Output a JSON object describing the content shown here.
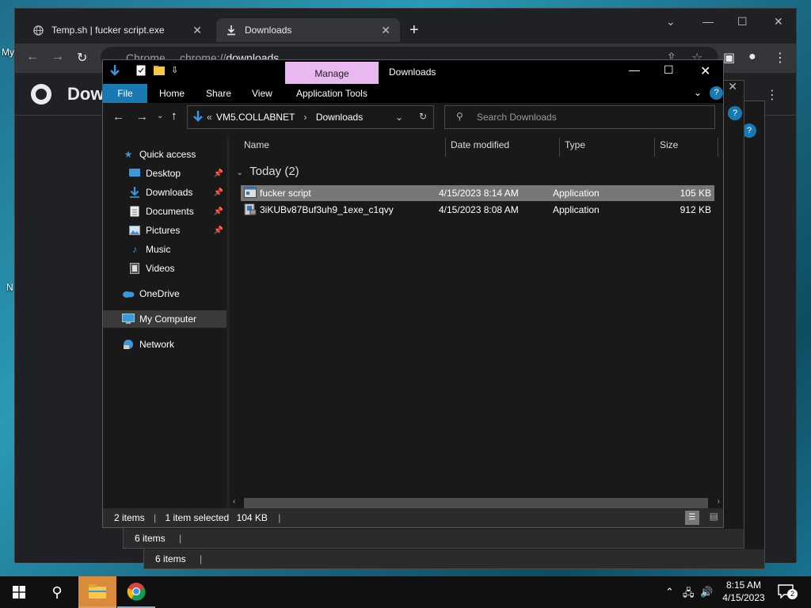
{
  "desktop": {
    "icon_labels": [
      "My",
      "N"
    ]
  },
  "chrome": {
    "tabs": [
      {
        "label": "Temp.sh | fucker script.exe",
        "icon": "globe-icon"
      },
      {
        "label": "Downloads",
        "icon": "download-icon"
      }
    ],
    "url_scheme": "chrome://",
    "url_path": "downloads",
    "omnibox_prefix": "Chrome",
    "page_title": "Dow"
  },
  "explorer": {
    "title": "Downloads",
    "manage_tab": "Manage",
    "ribbon_tabs": [
      "File",
      "Home",
      "Share",
      "View",
      "Application Tools"
    ],
    "address": {
      "root": "VM5.COLLABNET",
      "current": "Downloads"
    },
    "search_placeholder": "Search Downloads",
    "nav": [
      {
        "label": "Quick access",
        "icon": "star-icon"
      },
      {
        "label": "Desktop",
        "icon": "desktop-icon",
        "pinned": true
      },
      {
        "label": "Downloads",
        "icon": "download-icon",
        "pinned": true
      },
      {
        "label": "Documents",
        "icon": "document-icon",
        "pinned": true
      },
      {
        "label": "Pictures",
        "icon": "picture-icon",
        "pinned": true
      },
      {
        "label": "Music",
        "icon": "music-icon"
      },
      {
        "label": "Videos",
        "icon": "video-icon"
      },
      {
        "label": "OneDrive",
        "icon": "cloud-icon"
      },
      {
        "label": "My Computer",
        "icon": "computer-icon"
      },
      {
        "label": "Network",
        "icon": "network-icon"
      }
    ],
    "columns": [
      "Name",
      "Date modified",
      "Type",
      "Size"
    ],
    "group": "Today (2)",
    "files": [
      {
        "name": "fucker script",
        "date": "4/15/2023 8:14 AM",
        "type": "Application",
        "size": "105 KB",
        "selected": true
      },
      {
        "name": "3iKUBv87Buf3uh9_1exe_c1qvy",
        "date": "4/15/2023 8:08 AM",
        "type": "Application",
        "size": "912 KB",
        "selected": false
      }
    ],
    "status": {
      "items": "2 items",
      "selected": "1 item selected",
      "selected_size": "104 KB"
    }
  },
  "back_windows": [
    {
      "status": "6 items"
    },
    {
      "status": "6 items"
    }
  ],
  "taskbar": {
    "time": "8:15 AM",
    "date": "4/15/2023",
    "notification_count": "2"
  }
}
